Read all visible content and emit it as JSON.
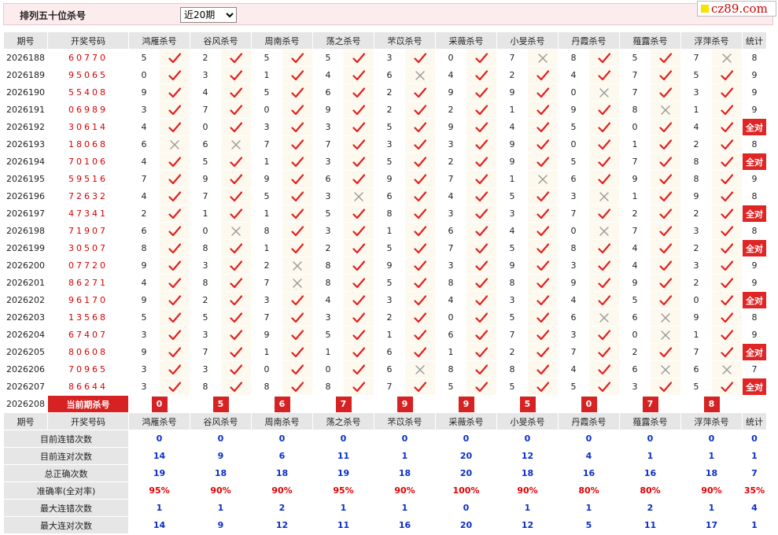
{
  "header": {
    "title": "排列五十位杀号",
    "period_select": "近20期",
    "logo": "cz89.com"
  },
  "columns": {
    "issue": "期号",
    "code": "开奖号码",
    "experts": [
      "鸿雁杀号",
      "谷风杀号",
      "周南杀号",
      "荡之杀号",
      "芣苡杀号",
      "采薇杀号",
      "小旻杀号",
      "丹霞杀号",
      "薤露杀号",
      "浮萍杀号"
    ],
    "count": "统计"
  },
  "rows": [
    {
      "issue": "2026188",
      "code": "60770",
      "picks": [
        [
          5,
          1
        ],
        [
          2,
          1
        ],
        [
          5,
          1
        ],
        [
          5,
          1
        ],
        [
          3,
          1
        ],
        [
          0,
          1
        ],
        [
          7,
          0
        ],
        [
          8,
          1
        ],
        [
          5,
          1
        ],
        [
          7,
          0
        ]
      ],
      "count": "8"
    },
    {
      "issue": "2026189",
      "code": "95065",
      "picks": [
        [
          0,
          1
        ],
        [
          3,
          1
        ],
        [
          1,
          1
        ],
        [
          4,
          1
        ],
        [
          6,
          0
        ],
        [
          4,
          1
        ],
        [
          2,
          1
        ],
        [
          4,
          1
        ],
        [
          7,
          1
        ],
        [
          5,
          1
        ]
      ],
      "count": "9"
    },
    {
      "issue": "2026190",
      "code": "55408",
      "picks": [
        [
          9,
          1
        ],
        [
          4,
          1
        ],
        [
          5,
          1
        ],
        [
          6,
          1
        ],
        [
          2,
          1
        ],
        [
          9,
          1
        ],
        [
          9,
          1
        ],
        [
          0,
          0
        ],
        [
          7,
          1
        ],
        [
          3,
          1
        ]
      ],
      "count": "9"
    },
    {
      "issue": "2026191",
      "code": "06989",
      "picks": [
        [
          3,
          1
        ],
        [
          7,
          1
        ],
        [
          0,
          1
        ],
        [
          9,
          1
        ],
        [
          2,
          1
        ],
        [
          2,
          1
        ],
        [
          1,
          1
        ],
        [
          9,
          1
        ],
        [
          8,
          0
        ],
        [
          1,
          1
        ]
      ],
      "count": "9"
    },
    {
      "issue": "2026192",
      "code": "30614",
      "picks": [
        [
          4,
          1
        ],
        [
          0,
          1
        ],
        [
          3,
          1
        ],
        [
          3,
          1
        ],
        [
          5,
          1
        ],
        [
          9,
          1
        ],
        [
          4,
          1
        ],
        [
          5,
          1
        ],
        [
          0,
          1
        ],
        [
          4,
          1
        ]
      ],
      "count": "全对"
    },
    {
      "issue": "2026193",
      "code": "18068",
      "picks": [
        [
          6,
          0
        ],
        [
          6,
          0
        ],
        [
          7,
          1
        ],
        [
          7,
          1
        ],
        [
          3,
          1
        ],
        [
          3,
          1
        ],
        [
          9,
          1
        ],
        [
          0,
          1
        ],
        [
          1,
          1
        ],
        [
          2,
          1
        ]
      ],
      "count": "8"
    },
    {
      "issue": "2026194",
      "code": "70106",
      "picks": [
        [
          4,
          1
        ],
        [
          5,
          1
        ],
        [
          1,
          1
        ],
        [
          3,
          1
        ],
        [
          5,
          1
        ],
        [
          2,
          1
        ],
        [
          9,
          1
        ],
        [
          5,
          1
        ],
        [
          7,
          1
        ],
        [
          8,
          1
        ]
      ],
      "count": "全对"
    },
    {
      "issue": "2026195",
      "code": "59516",
      "picks": [
        [
          7,
          1
        ],
        [
          9,
          1
        ],
        [
          9,
          1
        ],
        [
          6,
          1
        ],
        [
          9,
          1
        ],
        [
          7,
          1
        ],
        [
          1,
          0
        ],
        [
          6,
          1
        ],
        [
          9,
          1
        ],
        [
          8,
          1
        ]
      ],
      "count": "9"
    },
    {
      "issue": "2026196",
      "code": "72632",
      "picks": [
        [
          4,
          1
        ],
        [
          7,
          1
        ],
        [
          5,
          1
        ],
        [
          3,
          0
        ],
        [
          6,
          1
        ],
        [
          4,
          1
        ],
        [
          5,
          1
        ],
        [
          3,
          0
        ],
        [
          1,
          1
        ],
        [
          9,
          1
        ]
      ],
      "count": "8"
    },
    {
      "issue": "2026197",
      "code": "47341",
      "picks": [
        [
          2,
          1
        ],
        [
          1,
          1
        ],
        [
          1,
          1
        ],
        [
          5,
          1
        ],
        [
          8,
          1
        ],
        [
          3,
          1
        ],
        [
          3,
          1
        ],
        [
          7,
          1
        ],
        [
          2,
          1
        ],
        [
          2,
          1
        ]
      ],
      "count": "全对"
    },
    {
      "issue": "2026198",
      "code": "71907",
      "picks": [
        [
          6,
          1
        ],
        [
          0,
          0
        ],
        [
          8,
          1
        ],
        [
          3,
          1
        ],
        [
          1,
          1
        ],
        [
          6,
          1
        ],
        [
          4,
          1
        ],
        [
          0,
          0
        ],
        [
          7,
          1
        ],
        [
          3,
          1
        ]
      ],
      "count": "8"
    },
    {
      "issue": "2026199",
      "code": "30507",
      "picks": [
        [
          8,
          1
        ],
        [
          8,
          1
        ],
        [
          1,
          1
        ],
        [
          2,
          1
        ],
        [
          5,
          1
        ],
        [
          7,
          1
        ],
        [
          5,
          1
        ],
        [
          8,
          1
        ],
        [
          4,
          1
        ],
        [
          2,
          1
        ]
      ],
      "count": "全对"
    },
    {
      "issue": "2026200",
      "code": "07720",
      "picks": [
        [
          9,
          1
        ],
        [
          3,
          1
        ],
        [
          2,
          0
        ],
        [
          8,
          1
        ],
        [
          9,
          1
        ],
        [
          3,
          1
        ],
        [
          9,
          1
        ],
        [
          3,
          1
        ],
        [
          4,
          1
        ],
        [
          3,
          1
        ]
      ],
      "count": "9"
    },
    {
      "issue": "2026201",
      "code": "86271",
      "picks": [
        [
          4,
          1
        ],
        [
          8,
          1
        ],
        [
          7,
          0
        ],
        [
          8,
          1
        ],
        [
          5,
          1
        ],
        [
          8,
          1
        ],
        [
          8,
          1
        ],
        [
          9,
          1
        ],
        [
          9,
          1
        ],
        [
          2,
          1
        ]
      ],
      "count": "9"
    },
    {
      "issue": "2026202",
      "code": "96170",
      "picks": [
        [
          9,
          1
        ],
        [
          2,
          1
        ],
        [
          3,
          1
        ],
        [
          4,
          1
        ],
        [
          3,
          1
        ],
        [
          4,
          1
        ],
        [
          3,
          1
        ],
        [
          4,
          1
        ],
        [
          5,
          1
        ],
        [
          0,
          1
        ]
      ],
      "count": "全对"
    },
    {
      "issue": "2026203",
      "code": "13568",
      "picks": [
        [
          5,
          1
        ],
        [
          5,
          1
        ],
        [
          7,
          1
        ],
        [
          3,
          1
        ],
        [
          2,
          1
        ],
        [
          0,
          1
        ],
        [
          5,
          1
        ],
        [
          6,
          0
        ],
        [
          6,
          0
        ],
        [
          9,
          1
        ]
      ],
      "count": "8"
    },
    {
      "issue": "2026204",
      "code": "67407",
      "picks": [
        [
          3,
          1
        ],
        [
          3,
          1
        ],
        [
          9,
          1
        ],
        [
          5,
          1
        ],
        [
          1,
          1
        ],
        [
          6,
          1
        ],
        [
          7,
          1
        ],
        [
          3,
          1
        ],
        [
          0,
          0
        ],
        [
          1,
          1
        ]
      ],
      "count": "9"
    },
    {
      "issue": "2026205",
      "code": "80608",
      "picks": [
        [
          9,
          1
        ],
        [
          7,
          1
        ],
        [
          1,
          1
        ],
        [
          1,
          1
        ],
        [
          6,
          1
        ],
        [
          1,
          1
        ],
        [
          2,
          1
        ],
        [
          7,
          1
        ],
        [
          2,
          1
        ],
        [
          7,
          1
        ]
      ],
      "count": "全对"
    },
    {
      "issue": "2026206",
      "code": "70965",
      "picks": [
        [
          3,
          1
        ],
        [
          3,
          1
        ],
        [
          0,
          1
        ],
        [
          0,
          1
        ],
        [
          6,
          0
        ],
        [
          8,
          1
        ],
        [
          8,
          1
        ],
        [
          4,
          1
        ],
        [
          6,
          0
        ],
        [
          6,
          0
        ]
      ],
      "count": "7"
    },
    {
      "issue": "2026207",
      "code": "86644",
      "picks": [
        [
          3,
          1
        ],
        [
          8,
          1
        ],
        [
          8,
          1
        ],
        [
          8,
          1
        ],
        [
          7,
          1
        ],
        [
          5,
          1
        ],
        [
          5,
          1
        ],
        [
          5,
          1
        ],
        [
          3,
          1
        ],
        [
          5,
          1
        ]
      ],
      "count": "全对"
    }
  ],
  "current": {
    "issue": "2026208",
    "label": "当前期杀号",
    "kills": [
      "0",
      "5",
      "6",
      "7",
      "9",
      "9",
      "5",
      "0",
      "7",
      "8"
    ]
  },
  "stats": [
    {
      "label": "目前连错次数",
      "values": [
        "0",
        "0",
        "0",
        "0",
        "0",
        "0",
        "0",
        "0",
        "0",
        "0",
        "0"
      ]
    },
    {
      "label": "目前连对次数",
      "values": [
        "14",
        "9",
        "6",
        "11",
        "1",
        "20",
        "12",
        "4",
        "1",
        "1",
        "1"
      ]
    },
    {
      "label": "总正确次数",
      "values": [
        "19",
        "18",
        "18",
        "19",
        "18",
        "20",
        "18",
        "16",
        "16",
        "18",
        "7"
      ]
    },
    {
      "label": "准确率(全对率)",
      "values": [
        "95%",
        "90%",
        "90%",
        "95%",
        "90%",
        "100%",
        "90%",
        "80%",
        "80%",
        "90%",
        "35%"
      ],
      "red": true
    },
    {
      "label": "最大连错次数",
      "values": [
        "1",
        "1",
        "2",
        "1",
        "1",
        "0",
        "1",
        "1",
        "2",
        "1",
        "4"
      ]
    },
    {
      "label": "最大连对次数",
      "values": [
        "14",
        "9",
        "12",
        "11",
        "16",
        "20",
        "12",
        "5",
        "11",
        "17",
        "1"
      ]
    }
  ],
  "colors": {
    "check": "#e02020",
    "cross": "#999999",
    "accent": "#d62222",
    "stat_blue": "#0a2ec9",
    "header_bg": "#e6e6e6",
    "mark_bg": "#fdf9ee"
  }
}
